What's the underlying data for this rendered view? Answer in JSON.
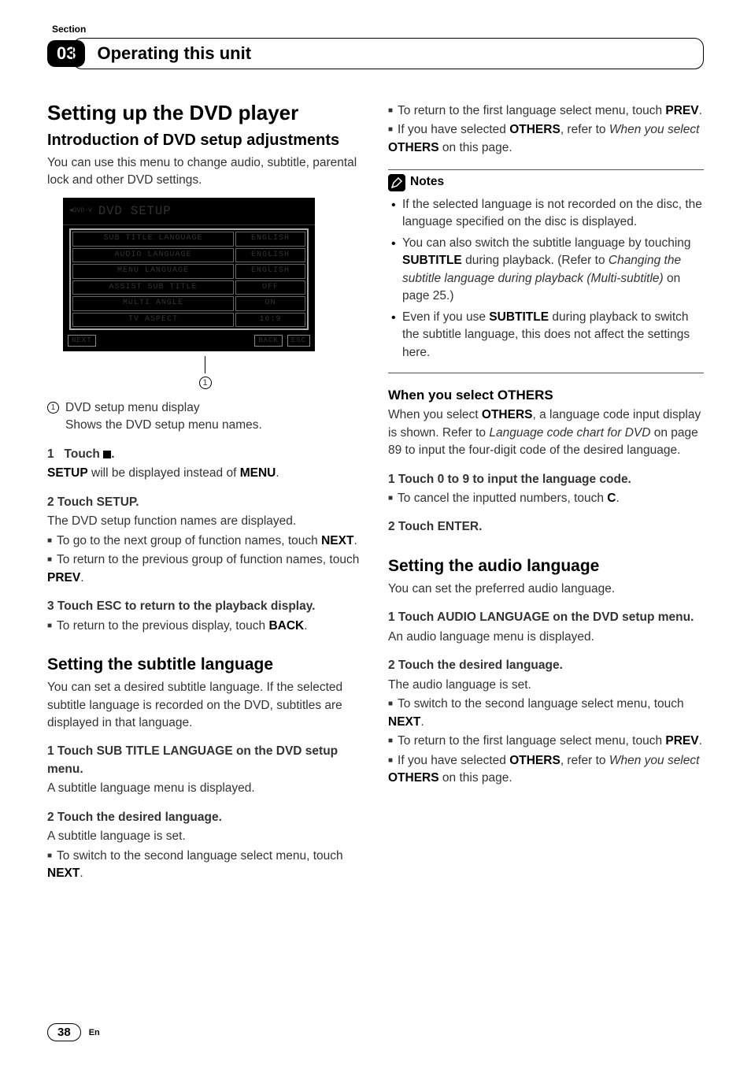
{
  "section_label": "Section",
  "section_number": "03",
  "header_title": "Operating this unit",
  "page_number": "38",
  "page_lang": "En",
  "left": {
    "h1": "Setting up the DVD player",
    "h2": "Introduction of DVD setup adjustments",
    "intro": "You can use this menu to change audio, subtitle, parental lock and other DVD settings.",
    "screen": {
      "title": "DVD SETUP",
      "tag_top": "DVD-V",
      "rows": [
        {
          "label": "SUB TITLE LANGUAGE",
          "value": "ENGLISH"
        },
        {
          "label": "AUDIO LANGUAGE",
          "value": "ENGLISH"
        },
        {
          "label": "MENU LANGUAGE",
          "value": "ENGLISH"
        },
        {
          "label": "ASSIST SUB TITLE",
          "value": "OFF"
        },
        {
          "label": "MULTI ANGLE",
          "value": "ON"
        },
        {
          "label": "TV ASPECT",
          "value": "16:9"
        }
      ],
      "next": "NEXT",
      "back": "BACK",
      "esc": "ESC"
    },
    "callout_num": "1",
    "callout_text": "DVD setup menu display",
    "callout_sub": "Shows the DVD setup menu names.",
    "step1_a": "1",
    "step1_b": "Touch ",
    "step1_c": ".",
    "step1_body_a": "SETUP",
    "step1_body_b": " will be displayed instead of ",
    "step1_body_c": "MENU",
    "step1_body_d": ".",
    "step2": "2   Touch SETUP.",
    "step2_body": "The DVD setup function names are displayed.",
    "step2_li1_a": "To go to the next group of function names, touch ",
    "step2_li1_b": "NEXT",
    "step2_li1_c": ".",
    "step2_li2_a": "To return to the previous group of function names, touch ",
    "step2_li2_b": "PREV",
    "step2_li2_c": ".",
    "step3": "3   Touch ESC to return to the playback display.",
    "step3_li_a": "To return to the previous display, touch ",
    "step3_li_b": "BACK",
    "step3_li_c": ".",
    "subtitle_h": "Setting the subtitle language",
    "subtitle_intro": "You can set a desired subtitle language. If the selected subtitle language is recorded on the DVD, subtitles are displayed in that language.",
    "sub_step1": "1   Touch SUB TITLE LANGUAGE on the DVD setup menu.",
    "sub_step1_body": "A subtitle language menu is displayed.",
    "sub_step2": "2   Touch the desired language.",
    "sub_step2_body": "A subtitle language is set.",
    "sub_step2_li1_a": "To switch to the second language select menu, touch ",
    "sub_step2_li1_b": "NEXT",
    "sub_step2_li1_c": "."
  },
  "right": {
    "top_li1_a": "To return to the first language select menu, touch ",
    "top_li1_b": "PREV",
    "top_li1_c": ".",
    "top_li2_a": "If you have selected ",
    "top_li2_b": "OTHERS",
    "top_li2_c": ", refer to ",
    "top_li2_d": "When you select ",
    "top_li2_e": "OTHERS",
    "top_li2_f": " on this page.",
    "notes_title": "Notes",
    "note1": "If the selected language is not recorded on the disc, the language specified on the disc is displayed.",
    "note2_a": "You can also switch the subtitle language by touching ",
    "note2_b": "SUBTITLE",
    "note2_c": " during playback. (Refer to ",
    "note2_d": "Changing the subtitle language during playback (Multi-subtitle)",
    "note2_e": " on page 25.)",
    "note3_a": "Even if you use ",
    "note3_b": "SUBTITLE",
    "note3_c": " during playback to switch the subtitle language, this does not affect the settings here.",
    "others_h": "When you select OTHERS",
    "others_intro_a": "When you select ",
    "others_intro_b": "OTHERS",
    "others_intro_c": ", a language code input display is shown. Refer to ",
    "others_intro_d": "Language code chart for DVD",
    "others_intro_e": " on page 89 to input the four-digit code of the desired language.",
    "others_step1": "1   Touch 0 to 9 to input the language code.",
    "others_step1_li_a": "To cancel the inputted numbers, touch ",
    "others_step1_li_b": "C",
    "others_step1_li_c": ".",
    "others_step2": "2   Touch ENTER.",
    "audio_h": "Setting the audio language",
    "audio_intro": "You can set the preferred audio language.",
    "audio_step1": "1   Touch AUDIO LANGUAGE on the DVD setup menu.",
    "audio_step1_body": "An audio language menu is displayed.",
    "audio_step2": "2   Touch the desired language.",
    "audio_step2_body": "The audio language is set.",
    "audio_li1_a": "To switch to the second language select menu, touch ",
    "audio_li1_b": "NEXT",
    "audio_li1_c": ".",
    "audio_li2_a": "To return to the first language select menu, touch ",
    "audio_li2_b": "PREV",
    "audio_li2_c": ".",
    "audio_li3_a": "If you have selected ",
    "audio_li3_b": "OTHERS",
    "audio_li3_c": ", refer to ",
    "audio_li3_d": "When you select ",
    "audio_li3_e": "OTHERS",
    "audio_li3_f": " on this page."
  }
}
